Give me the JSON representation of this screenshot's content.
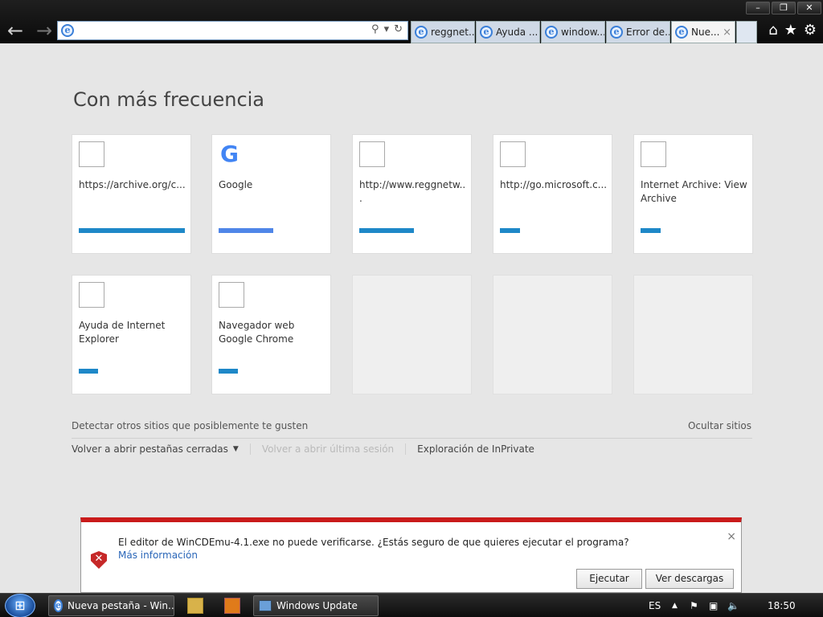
{
  "browser": {
    "address_value": "",
    "tabs": [
      {
        "label": "reggnet...",
        "active": false
      },
      {
        "label": "Ayuda ...",
        "active": false
      },
      {
        "label": "window...",
        "active": false
      },
      {
        "label": "Error de...",
        "active": false
      },
      {
        "label": "Nue...",
        "active": true
      }
    ],
    "tab_close": "×",
    "window_buttons": {
      "minimize": "–",
      "restore": "❐",
      "close": "✕"
    }
  },
  "page": {
    "heading": "Con más frecuencia",
    "tiles": [
      {
        "title": "https://archive.org/c...",
        "icon": "blank",
        "bar_fraction": 0.99
      },
      {
        "title": "Google",
        "icon": "google",
        "bar_fraction": 0.5
      },
      {
        "title": "http://www.reggnetw...",
        "icon": "blank",
        "bar_fraction": 0.5
      },
      {
        "title": "http://go.microsoft.c...",
        "icon": "blank",
        "bar_fraction": 0.18
      },
      {
        "title": "Internet Archive: View Archive",
        "icon": "blank",
        "bar_fraction": 0.18
      },
      {
        "title": "Ayuda de Internet Explorer",
        "icon": "blank",
        "bar_fraction": 0.18
      },
      {
        "title": "Navegador web Google Chrome",
        "icon": "blank",
        "bar_fraction": 0.18
      }
    ],
    "google_glyph": "G",
    "detect_text": "Detectar otros sitios que posiblemente te gusten",
    "hide_text": "Ocultar sitios",
    "reopen_tabs": "Volver a abrir pestañas cerradas",
    "reopen_session": "Volver a abrir última sesión",
    "inprivate": "Exploración de InPrivate"
  },
  "notification": {
    "message": "El editor de WinCDEmu-4.1.exe no puede verificarse. ¿Estás seguro de que quieres ejecutar el programa?",
    "more_info": "Más información",
    "run_button": "Ejecutar",
    "downloads_button": "Ver descargas",
    "close": "×"
  },
  "taskbar": {
    "items": [
      {
        "label": "Nueva pestaña - Win..."
      },
      {
        "label": "Windows Update"
      }
    ],
    "language": "ES",
    "time": "18:50"
  }
}
